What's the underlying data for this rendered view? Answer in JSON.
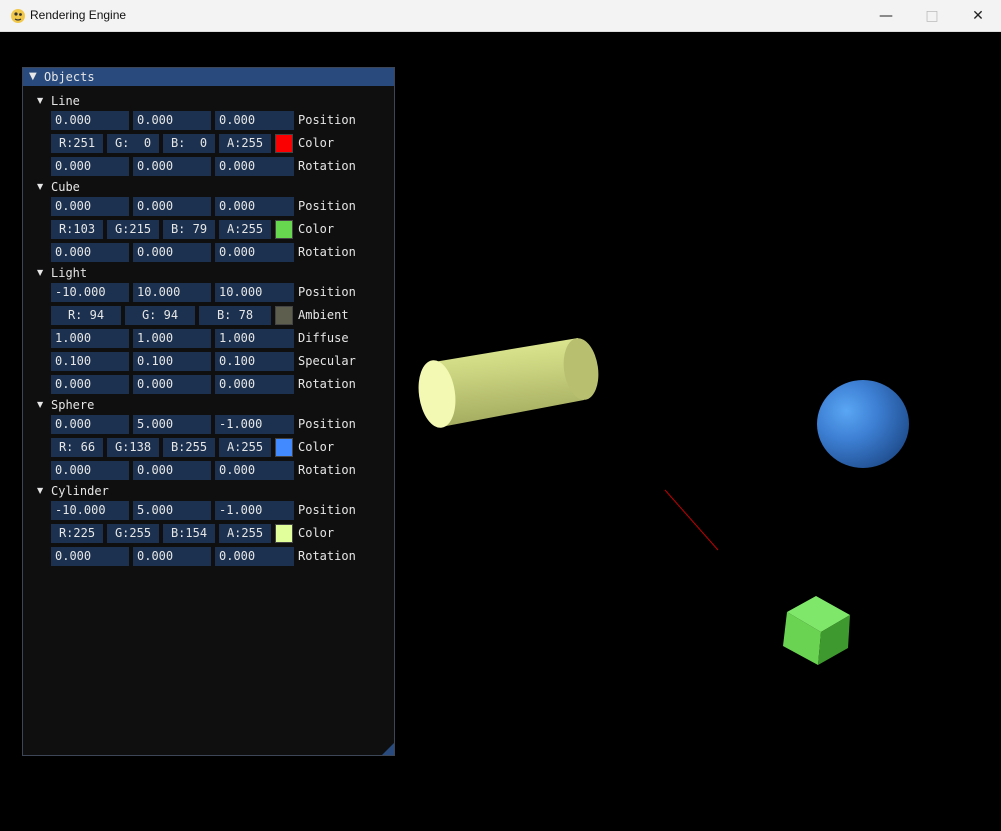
{
  "window": {
    "title": "Rendering Engine"
  },
  "panel": {
    "title": "Objects"
  },
  "objects": {
    "line": {
      "name": "Line",
      "position": [
        "0.000",
        "0.000",
        "0.000"
      ],
      "position_label": "Position",
      "color": [
        "R:251",
        "G:  0",
        "B:  0",
        "A:255"
      ],
      "color_label": "Color",
      "swatch": "#fb0000",
      "rotation": [
        "0.000",
        "0.000",
        "0.000"
      ],
      "rotation_label": "Rotation"
    },
    "cube": {
      "name": "Cube",
      "position": [
        "0.000",
        "0.000",
        "0.000"
      ],
      "position_label": "Position",
      "color": [
        "R:103",
        "G:215",
        "B: 79",
        "A:255"
      ],
      "color_label": "Color",
      "swatch": "#67d74f",
      "rotation": [
        "0.000",
        "0.000",
        "0.000"
      ],
      "rotation_label": "Rotation"
    },
    "light": {
      "name": "Light",
      "position": [
        "-10.000",
        "10.000",
        "10.000"
      ],
      "position_label": "Position",
      "ambient": [
        "R: 94",
        "G: 94",
        "B: 78"
      ],
      "ambient_label": "Ambient",
      "ambient_swatch": "#5e5e4e",
      "diffuse": [
        "1.000",
        "1.000",
        "1.000"
      ],
      "diffuse_label": "Diffuse",
      "specular": [
        "0.100",
        "0.100",
        "0.100"
      ],
      "specular_label": "Specular",
      "rotation": [
        "0.000",
        "0.000",
        "0.000"
      ],
      "rotation_label": "Rotation"
    },
    "sphere": {
      "name": "Sphere",
      "position": [
        "0.000",
        "5.000",
        "-1.000"
      ],
      "position_label": "Position",
      "color": [
        "R: 66",
        "G:138",
        "B:255",
        "A:255"
      ],
      "color_label": "Color",
      "swatch": "#428aff",
      "rotation": [
        "0.000",
        "0.000",
        "0.000"
      ],
      "rotation_label": "Rotation"
    },
    "cylinder": {
      "name": "Cylinder",
      "position": [
        "-10.000",
        "5.000",
        "-1.000"
      ],
      "position_label": "Position",
      "color": [
        "R:225",
        "G:255",
        "B:154",
        "A:255"
      ],
      "color_label": "Color",
      "swatch": "#e1ff9a",
      "rotation": [
        "0.000",
        "0.000",
        "0.000"
      ],
      "rotation_label": "Rotation"
    }
  },
  "colors": {
    "panel_bg": "#0f0f10",
    "title_bg": "#284a7c",
    "field_bg": "#1b314f",
    "text": "#e6e6e6"
  }
}
